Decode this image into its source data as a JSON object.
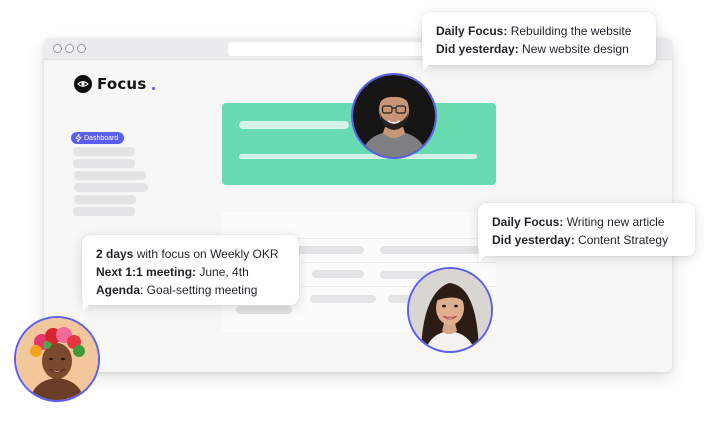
{
  "app": {
    "logo_text": "Focus",
    "accent_color": "#5b5ef0",
    "hero_color": "#69dbb0"
  },
  "sidebar": {
    "active_item": "Dashboard"
  },
  "bubbles": {
    "top": {
      "line1_label": "Daily Focus:",
      "line1_value": " Rebuilding the website",
      "line2_label": "Did yesterday:",
      "line2_value": " New website design"
    },
    "right": {
      "line1_label": "Daily Focus:",
      "line1_value": " Writing new article",
      "line2_label": "Did yesterday:",
      "line2_value": " Content Strategy"
    },
    "left": {
      "line1_label": "2 days",
      "line1_value": " with focus on Weekly OKR",
      "line2_label": "Next 1:1 meeting:",
      "line2_value": " June, 4th",
      "line3_label": "Agenda",
      "line3_value": ": Goal-setting meeting"
    }
  }
}
